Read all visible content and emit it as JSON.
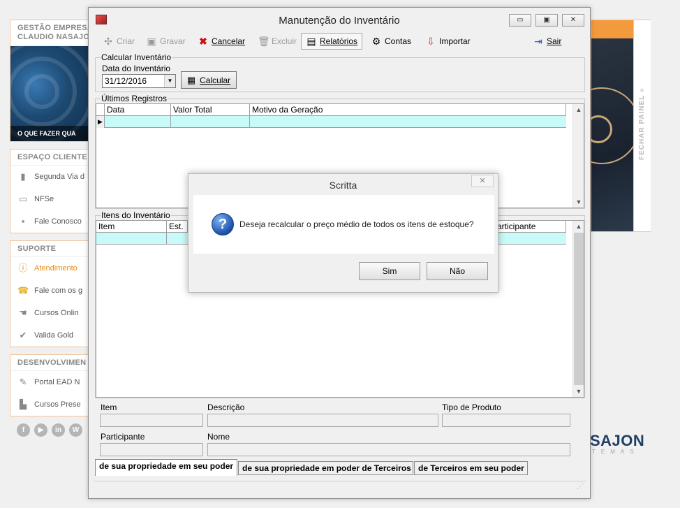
{
  "background": {
    "left_panels": [
      {
        "head": "GESTÃO EMPRESA",
        "head2": "CLAUDIO NASAJO",
        "caption": "O QUE FAZER QUA"
      },
      {
        "head": "ESPAÇO CLIENTE",
        "items": [
          "Segunda Via d",
          "NFSe",
          "Fale Conosco"
        ]
      },
      {
        "head": "SUPORTE",
        "items": [
          "Atendimento",
          "Fale com os g",
          "Cursos Onlin",
          "Valida Gold"
        ]
      },
      {
        "head": "DESENVOLVIMEN",
        "items": [
          "Portal EAD N",
          "Cursos Prese"
        ]
      }
    ],
    "social": [
      "f",
      "▶",
      "in",
      "W"
    ],
    "right_panel_label": "FECHAR PAINEL «",
    "brand": "SAJON",
    "brand_sub": "TEMAS"
  },
  "window": {
    "title": "Manutenção do Inventário",
    "controls": [
      "▭",
      "▣",
      "✕"
    ],
    "toolbar": {
      "criar": "Criar",
      "gravar": "Gravar",
      "cancelar": "Cancelar",
      "excluir": "Excluir",
      "relatorios": "Relatórios",
      "contas": "Contas",
      "importar": "Importar",
      "sair": "Sair"
    },
    "calcular_group": "Calcular Inventário",
    "data_label": "Data do Inventário",
    "data_value": "31/12/2016",
    "calcular_button": "Calcular",
    "ultimos_group": "Últimos Registros",
    "ultimos_columns": [
      "Data",
      "Valor Total",
      "Motivo da Geração"
    ],
    "itens_group": "Itens do Inventário",
    "itens_columns": [
      "Item",
      "Est.",
      "articipante"
    ],
    "fields": {
      "item": "Item",
      "descricao": "Descrição",
      "tipo_produto": "Tipo de Produto",
      "participante": "Participante",
      "nome": "Nome"
    },
    "tabs": [
      "de sua propriedade em seu poder",
      "de sua propriedade em poder de Terceiros",
      "de Terceiros em seu poder"
    ]
  },
  "dialog": {
    "title": "Scritta",
    "close": "✕",
    "message": "Deseja recalcular o preço médio de todos os itens de estoque?",
    "yes": "Sim",
    "no": "Não"
  }
}
